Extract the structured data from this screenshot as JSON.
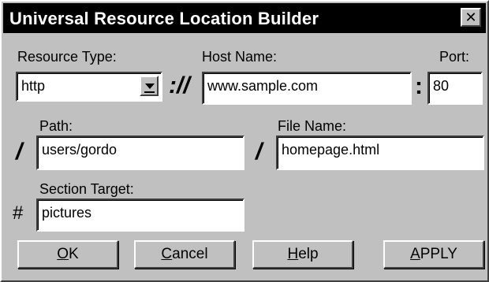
{
  "window": {
    "title": "Universal Resource Location Builder",
    "close_glyph": "✕"
  },
  "resource_type": {
    "label": "Resource Type:",
    "value": "http"
  },
  "host_name": {
    "label": "Host Name:",
    "value": "www.sample.com"
  },
  "port": {
    "label": "Port:",
    "value": "80"
  },
  "path": {
    "label": "Path:",
    "value": "users/gordo"
  },
  "file_name": {
    "label": "File Name:",
    "value": "homepage.html"
  },
  "section_target": {
    "label": "Section Target:",
    "value": "pictures"
  },
  "separators": {
    "scheme": "://",
    "port": ":",
    "path": "/",
    "file": "/",
    "section": "#"
  },
  "buttons": {
    "ok": {
      "mnemonic": "O",
      "rest": "K"
    },
    "cancel": {
      "mnemonic": "C",
      "rest": "ancel"
    },
    "help": {
      "mnemonic": "H",
      "rest": "elp"
    },
    "apply": {
      "mnemonic": "A",
      "rest": "PPLY"
    }
  }
}
